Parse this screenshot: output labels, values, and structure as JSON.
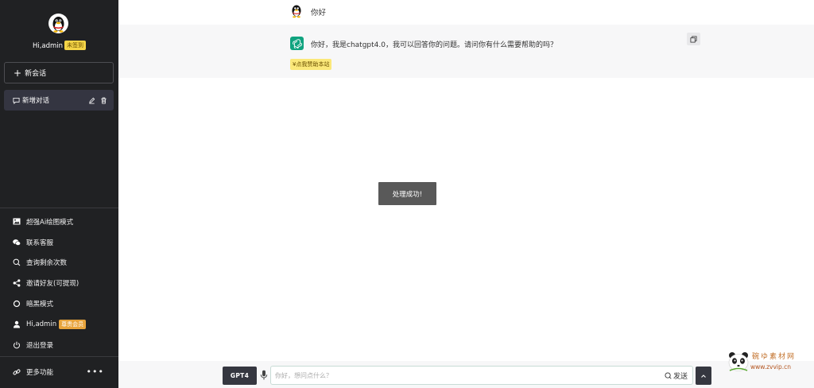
{
  "sidebar": {
    "greeting": "Hi,admin",
    "signin_badge": "未签到",
    "new_chat_label": "新会话",
    "conversation": {
      "title": "新增对话"
    },
    "menu": [
      {
        "label": "超强Ai绘图模式",
        "icon": "image-icon"
      },
      {
        "label": "联系客服",
        "icon": "wechat-icon"
      },
      {
        "label": "查询剩余次数",
        "icon": "search-icon"
      },
      {
        "label": "邀请好友(可提现)",
        "icon": "share-icon"
      },
      {
        "label": "暗黑模式",
        "icon": "circle-icon"
      },
      {
        "label": "Hi,admin",
        "icon": "user-icon",
        "badge": "尊贵会员"
      },
      {
        "label": "退出登录",
        "icon": "power-icon"
      }
    ],
    "more_label": "更多功能"
  },
  "chat": {
    "user_message": "你好",
    "bot_message": "你好，我是chatgpt4.0，我可以回答你的问题。请问你有什么需要帮助的吗？",
    "donate_label": "¥点我赞助本站"
  },
  "toast": "处理成功!",
  "input": {
    "model_label": "GPT4",
    "placeholder": "你好，想问点什么？",
    "send_label": "发送"
  },
  "watermark": {
    "line1": "碗ゆ素材网",
    "line2": "www.zvvip.cn"
  },
  "colors": {
    "sidebar_bg": "#202123",
    "accent_green": "#10a37f",
    "badge_yellow": "#f5d547",
    "badge_orange": "#e8a43c"
  }
}
